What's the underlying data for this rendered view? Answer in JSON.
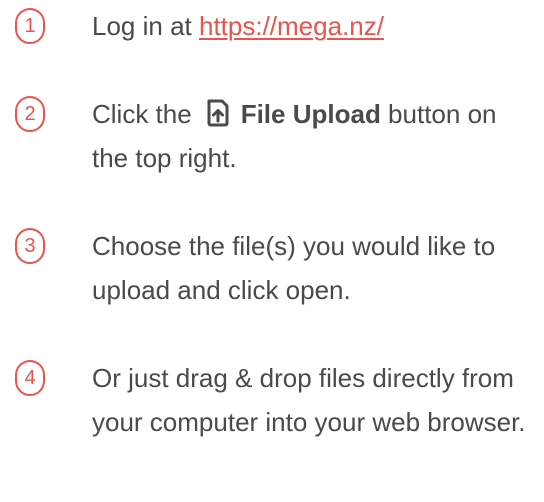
{
  "colors": {
    "accent": "#e8554e",
    "text": "#4a4a4a"
  },
  "steps": [
    {
      "number": "1",
      "prefix": "Log in at ",
      "link": "https://mega.nz/"
    },
    {
      "number": "2",
      "prefix": "Click the",
      "icon": "file-upload-icon",
      "button_label": "File Upload",
      "suffix": " button on the top right."
    },
    {
      "number": "3",
      "text": "Choose the file(s) you would like to upload and click open."
    },
    {
      "number": "4",
      "text": "Or just drag & drop files directly from your computer into your web browser."
    }
  ]
}
